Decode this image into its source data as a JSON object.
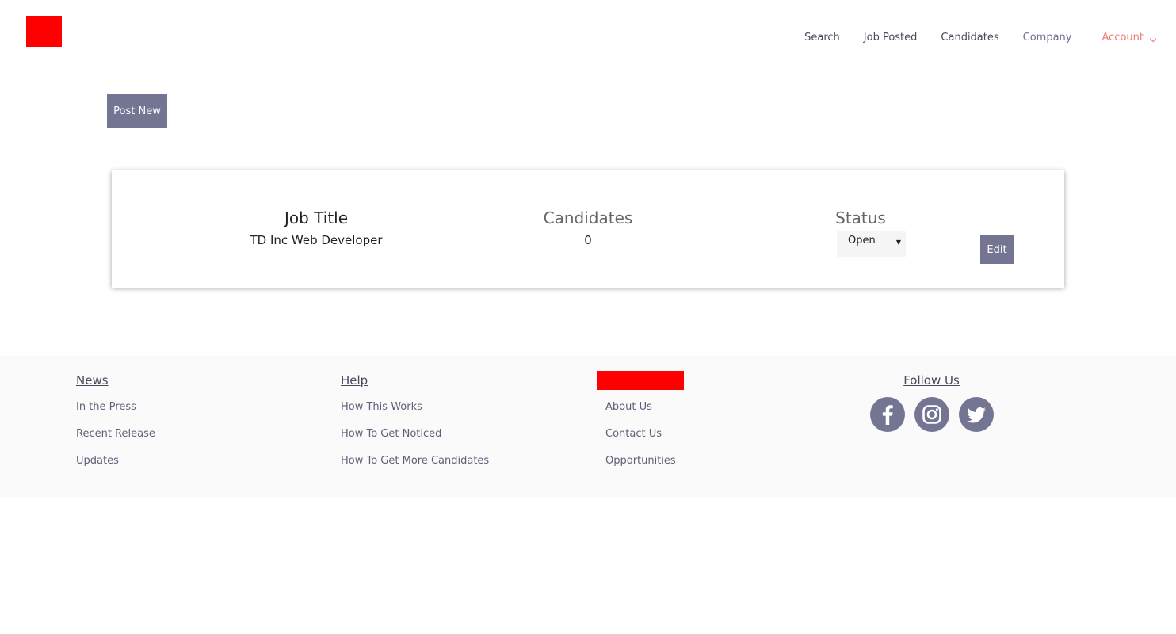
{
  "header": {
    "nav": {
      "search": "Search",
      "job_posted": "Job Posted",
      "candidates": "Candidates",
      "company": "Company",
      "account": "Account"
    }
  },
  "actions": {
    "post_new": "Post New"
  },
  "job_card": {
    "title_header": "Job Title",
    "title_value": "TD Inc Web Developer",
    "candidates_header": "Candidates",
    "candidates_value": "0",
    "status_header": "Status",
    "status_value": "Open",
    "edit_label": "Edit"
  },
  "footer": {
    "news": {
      "heading": "News",
      "links": [
        "In the Press",
        "Recent Release",
        "Updates"
      ]
    },
    "help": {
      "heading": "Help",
      "links": [
        "How This Works",
        "How To Get Noticed",
        "How To Get More Candidates"
      ]
    },
    "company": {
      "links": [
        "About Us",
        "Contact Us",
        "Opportunities"
      ]
    },
    "follow": {
      "heading": "Follow Us",
      "icons": [
        "facebook-icon",
        "instagram-icon",
        "twitter-icon"
      ]
    }
  },
  "colors": {
    "brand_red": "#ff0000",
    "button": "#737592",
    "account_accent": "#f07a70",
    "footer_bg": "#fafafa"
  }
}
